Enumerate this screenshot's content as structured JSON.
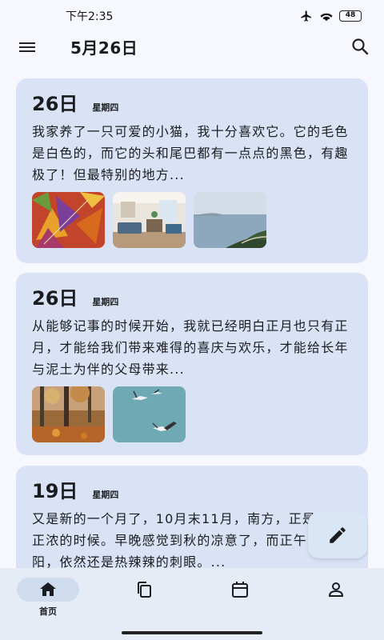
{
  "status_bar": {
    "time": "下午2:35",
    "battery": "48",
    "icons": [
      "airplane-icon",
      "wifi-icon",
      "battery-icon"
    ]
  },
  "app_bar": {
    "title": "5月26日",
    "icons": [
      "menu-icon",
      "search-icon"
    ]
  },
  "entries": [
    {
      "day": "26日",
      "weekday": "星期四",
      "text": "我家养了一只可爱的小猫，我十分喜欢它。它的毛色是白色的，而它的头和尾巴都有一点点的黑色，有趣极了！但最特别的地方...",
      "images": [
        "autumn-leaves-photo",
        "living-room-photo",
        "sea-coast-photo"
      ]
    },
    {
      "day": "26日",
      "weekday": "星期四",
      "text": "从能够记事的时候开始，我就已经明白正月也只有正月，才能给我们带来难得的喜庆与欢乐，才能给长年与泥土为伴的父母带来...",
      "images": [
        "autumn-forest-photo",
        "seagulls-photo"
      ]
    },
    {
      "day": "19日",
      "weekday": "星期四",
      "text": "又是新的一个月了，10月末11月，南方，正是秋意正浓的时候。早晚感觉到秋的凉意了，而正午的秋阳，依然还是热辣辣的刺眼。...",
      "images": []
    }
  ],
  "fab": {
    "icon": "edit-icon"
  },
  "bottom_nav": {
    "items": [
      {
        "icon": "home-icon",
        "label": "首页",
        "active": true
      },
      {
        "icon": "copy-icon",
        "label": "",
        "active": false
      },
      {
        "icon": "calendar-icon",
        "label": "",
        "active": false
      },
      {
        "icon": "person-icon",
        "label": "",
        "active": false
      }
    ]
  },
  "colors": {
    "card": "#d9e3f5",
    "background": "#f6f8fd",
    "nav": "#e6ecf6"
  }
}
